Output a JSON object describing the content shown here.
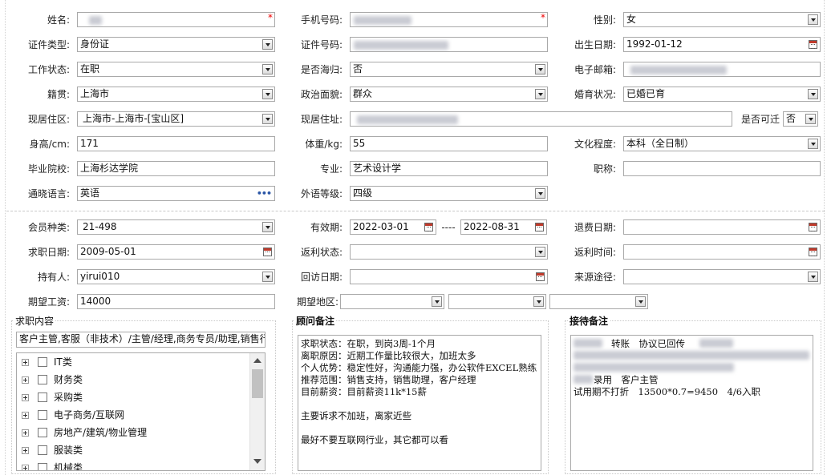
{
  "row1": {
    "name_label": "姓名:",
    "name_value": "",
    "phone_label": "手机号码:",
    "phone_value": "",
    "gender_label": "性别:",
    "gender_value": "女"
  },
  "row2": {
    "idtype_label": "证件类型:",
    "idtype_value": "身份证",
    "idno_label": "证件号码:",
    "idno_value": "",
    "birth_label": "出生日期:",
    "birth_value": "1992-01-12"
  },
  "row3": {
    "work_label": "工作状态:",
    "work_value": "在职",
    "returnee_label": "是否海归:",
    "returnee_value": "否",
    "email_label": "电子邮箱:",
    "email_value": ""
  },
  "row4": {
    "native_label": "籍贯:",
    "native_value": "上海市",
    "political_label": "政治面貌:",
    "political_value": "群众",
    "marital_label": "婚育状况:",
    "marital_value": "已婚已育"
  },
  "row5": {
    "area_label": "现居住区:",
    "area_value": "上海市-上海市-[宝山区]",
    "address_label": "现居住址:",
    "address_value": "",
    "relocate_label": "是否可迁",
    "relocate_value": "否"
  },
  "row6": {
    "height_label": "身高/cm:",
    "height_value": "171",
    "weight_label": "体重/kg:",
    "weight_value": "55",
    "edu_label": "文化程度:",
    "edu_value": "本科（全日制）"
  },
  "row7": {
    "school_label": "毕业院校:",
    "school_value": "上海杉达学院",
    "major_label": "专业:",
    "major_value": "艺术设计学",
    "title_label": "职称:",
    "title_value": ""
  },
  "row8": {
    "lang_label": "通晓语言:",
    "lang_value": "英语",
    "level_label": "外语等级:",
    "level_value": "四级"
  },
  "member": {
    "type_label": "会员种类:",
    "type_value": "21-498",
    "valid_label": "有效期:",
    "valid_from": "2022-03-01",
    "dash": "----",
    "valid_to": "2022-08-31",
    "refund_label": "退费日期:",
    "refund_value": "",
    "jobdate_label": "求职日期:",
    "jobdate_value": "2009-05-01",
    "rebate_status_label": "返利状态:",
    "rebate_status_value": "",
    "rebate_time_label": "返利时间:",
    "rebate_time_value": "",
    "holder_label": "持有人:",
    "holder_value": "yirui010",
    "visit_label": "回访日期:",
    "visit_value": "",
    "source_label": "来源途径:",
    "source_value": "",
    "salary_label": "期望工资:",
    "salary_value": "14000",
    "region_label": "期望地区:",
    "region1": "",
    "region2": "",
    "region3": ""
  },
  "job": {
    "title": "求职内容",
    "summary": "客户主管,客服（非技术）/主管/经理,商务专员/助理,销售行",
    "categories": [
      "IT类",
      "财务类",
      "采购类",
      "电子商务/互联网",
      "房地产/建筑/物业管理",
      "服装类",
      "机械类"
    ]
  },
  "consultant": {
    "title": "顾问备注",
    "lines": [
      "求职状态：在职，到岗3周-1个月",
      "离职原因：近期工作量比较很大，加班太多",
      "个人优势：稳定性好，沟通能力强，办公软件EXCEL熟练",
      "推荐范围：销售支持，销售助理，客户经理",
      "目前薪资：目前薪资11k*15薪",
      "",
      "主要诉求不加班，离家近些",
      "",
      "最好不要互联网行业，其它都可以看"
    ]
  },
  "reception": {
    "title": "接待备注",
    "line1": "转账　协议已回传",
    "line4": "录用　客户主管",
    "line5": "试用期不打折　13500*0.7=9450　4/6入职"
  },
  "colors": {
    "required": "#e00000",
    "border": "#a9a9a9",
    "calendar": "#c03a2b"
  }
}
